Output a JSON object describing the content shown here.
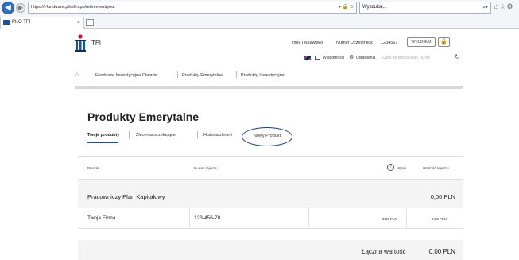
{
  "browser": {
    "url": "https://i-fundusze.pl/atfi-app/retirement/your",
    "search_placeholder": "Wyszukaj...",
    "tab_title": "PKO TFI",
    "tab_close": "×",
    "back_icon": "back-arrow-icon",
    "forward_icon": "forward-arrow-icon",
    "addr_tools": "▾ 🔒 ↻",
    "search_icon_glyph": "⌕▾",
    "chrome_icons_glyphs": "⌂☆⚙"
  },
  "header": {
    "logo_text": "TFI",
    "user_name": "Imię i Nazwisko",
    "participant_label": "Numer Uczestnika:",
    "participant_number": "1234567",
    "logout_label": "WYLOGUJ",
    "lock_glyph": "🔒",
    "messages_label": "Wiadomości",
    "settings_label": "Ustawienia",
    "session_label": "Czas do końca sesji: 09:43",
    "gear_glyph": "⚙",
    "refresh_glyph": "↻"
  },
  "breadcrumb": {
    "home_glyph": "⌂",
    "items": [
      "Fundusze Inwestycyjne Otwarte",
      "Produkty Emerytalne",
      "Produkty Inwestycyjne"
    ]
  },
  "main": {
    "title": "Produkty Emerytalne",
    "tabs": [
      {
        "label": "Twoje produkty",
        "active": true
      },
      {
        "label": "Zlecenia oczekujące",
        "active": false
      },
      {
        "label": "Historia zleceń",
        "active": false
      }
    ],
    "new_product_label": "Nowy Produkt"
  },
  "table": {
    "columns": [
      "Produkt",
      "Numer rejestru",
      "Wynik",
      "Wartość rejestru"
    ],
    "info_glyph": "?",
    "group": {
      "name": "Pracowniczy Plan Kapitałowy",
      "value": "0,00 PLN"
    },
    "rows": [
      {
        "product": "Twoja Firma",
        "register": "123-456-78",
        "result": "0,00 PLN",
        "value": "0,00 PLN"
      }
    ],
    "total_label": "Łączna wartość",
    "total_value": "0,00 PLN"
  },
  "colors": {
    "brand": "#1a4fa0",
    "accent_red": "#c8102e",
    "circle": "#1a3a8a"
  }
}
